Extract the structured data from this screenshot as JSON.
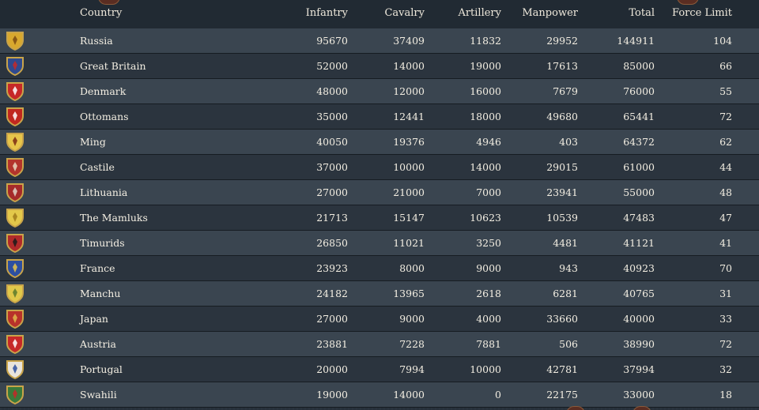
{
  "table": {
    "headers": {
      "country": "Country",
      "infantry": "Infantry",
      "cavalry": "Cavalry",
      "artillery": "Artillery",
      "manpower": "Manpower",
      "total": "Total",
      "force_limit": "Force Limit"
    },
    "rows": [
      {
        "country": "Russia",
        "infantry": "95670",
        "cavalry": "37409",
        "artillery": "11832",
        "manpower": "29952",
        "total": "144911",
        "force_limit": "104",
        "flag_icon": "russia-flag-icon",
        "flag_colors": [
          "#d8a82e",
          "#7a4a12"
        ]
      },
      {
        "country": "Great Britain",
        "infantry": "52000",
        "cavalry": "14000",
        "artillery": "19000",
        "manpower": "17613",
        "total": "85000",
        "force_limit": "66",
        "flag_icon": "great-britain-flag-icon",
        "flag_colors": [
          "#2f4a8e",
          "#c62828"
        ]
      },
      {
        "country": "Denmark",
        "infantry": "48000",
        "cavalry": "12000",
        "artillery": "16000",
        "manpower": "7679",
        "total": "76000",
        "force_limit": "55",
        "flag_icon": "denmark-flag-icon",
        "flag_colors": [
          "#c62828",
          "#ffffff"
        ]
      },
      {
        "country": "Ottomans",
        "infantry": "35000",
        "cavalry": "12441",
        "artillery": "18000",
        "manpower": "49680",
        "total": "65441",
        "force_limit": "72",
        "flag_icon": "ottomans-flag-icon",
        "flag_colors": [
          "#c0271f",
          "#ffffff"
        ]
      },
      {
        "country": "Ming",
        "infantry": "40050",
        "cavalry": "19376",
        "artillery": "4946",
        "manpower": "403",
        "total": "64372",
        "force_limit": "62",
        "flag_icon": "ming-flag-icon",
        "flag_colors": [
          "#e7c54a",
          "#7a2a12"
        ]
      },
      {
        "country": "Castile",
        "infantry": "37000",
        "cavalry": "10000",
        "artillery": "14000",
        "manpower": "29015",
        "total": "61000",
        "force_limit": "44",
        "flag_icon": "castile-flag-icon",
        "flag_colors": [
          "#b3342c",
          "#e9d9c0"
        ]
      },
      {
        "country": "Lithuania",
        "infantry": "27000",
        "cavalry": "21000",
        "artillery": "7000",
        "manpower": "23941",
        "total": "55000",
        "force_limit": "48",
        "flag_icon": "lithuania-flag-icon",
        "flag_colors": [
          "#a52a2a",
          "#e0d6c8"
        ]
      },
      {
        "country": "The Mamluks",
        "infantry": "21713",
        "cavalry": "15147",
        "artillery": "10623",
        "manpower": "10539",
        "total": "47483",
        "force_limit": "47",
        "flag_icon": "mamluks-flag-icon",
        "flag_colors": [
          "#e3c84a",
          "#a07a1a"
        ]
      },
      {
        "country": "Timurids",
        "infantry": "26850",
        "cavalry": "11021",
        "artillery": "3250",
        "manpower": "4481",
        "total": "41121",
        "force_limit": "41",
        "flag_icon": "timurids-flag-icon",
        "flag_colors": [
          "#b02a2a",
          "#1a1a1a"
        ]
      },
      {
        "country": "France",
        "infantry": "23923",
        "cavalry": "8000",
        "artillery": "9000",
        "manpower": "943",
        "total": "40923",
        "force_limit": "70",
        "flag_icon": "france-flag-icon",
        "flag_colors": [
          "#2d4fa0",
          "#e8c44a"
        ]
      },
      {
        "country": "Manchu",
        "infantry": "24182",
        "cavalry": "13965",
        "artillery": "2618",
        "manpower": "6281",
        "total": "40765",
        "force_limit": "31",
        "flag_icon": "manchu-flag-icon",
        "flag_colors": [
          "#e0c84a",
          "#5a7a2a"
        ]
      },
      {
        "country": "Japan",
        "infantry": "27000",
        "cavalry": "9000",
        "artillery": "4000",
        "manpower": "33660",
        "total": "40000",
        "force_limit": "33",
        "flag_icon": "japan-flag-icon",
        "flag_colors": [
          "#b8322a",
          "#e0b84a"
        ]
      },
      {
        "country": "Austria",
        "infantry": "23881",
        "cavalry": "7228",
        "artillery": "7881",
        "manpower": "506",
        "total": "38990",
        "force_limit": "72",
        "flag_icon": "austria-flag-icon",
        "flag_colors": [
          "#c62828",
          "#ffffff"
        ]
      },
      {
        "country": "Portugal",
        "infantry": "20000",
        "cavalry": "7994",
        "artillery": "10000",
        "manpower": "42781",
        "total": "37994",
        "force_limit": "32",
        "flag_icon": "portugal-flag-icon",
        "flag_colors": [
          "#e9e4dc",
          "#2d4fa0"
        ]
      },
      {
        "country": "Swahili",
        "infantry": "19000",
        "cavalry": "14000",
        "artillery": "0",
        "manpower": "22175",
        "total": "33000",
        "force_limit": "18",
        "flag_icon": "swahili-flag-icon",
        "flag_colors": [
          "#3a7a3a",
          "#c62828"
        ]
      }
    ]
  },
  "colors": {
    "background": "#27313b",
    "row_odd": "#3a4550",
    "row_even": "#2b343e",
    "text": "#f3eee2",
    "shield_border": "#c9a44a"
  }
}
